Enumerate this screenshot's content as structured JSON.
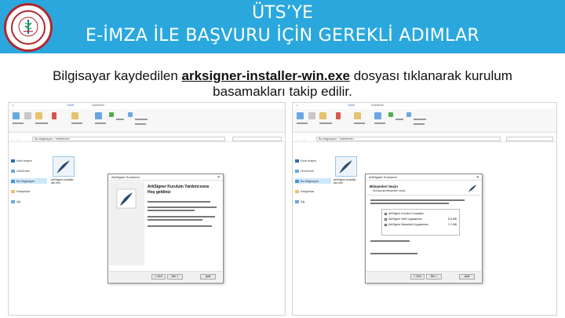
{
  "header": {
    "title_line1": "ÜTS’YE",
    "title_line2": "E-İMZA İLE BAŞVURU İÇİN GEREKLİ ADIMLAR",
    "band_color": "#2aa8de",
    "logo_icon": "university-seal-icon"
  },
  "instruction": {
    "before": "Bilgisayar kaydedilen ",
    "file_name": "arksigner-installer-win.exe",
    "after_line1": " dosyası tıklanarak kurulum",
    "line2": "basamakları takip edilir."
  },
  "left_screenshot": {
    "window_title": "İndirilenler",
    "ribbon_tab_manage": "Yönet",
    "address_nav": "←  →  ↑",
    "address_path": "Bu bilgisayar  ›  İndirilenler",
    "nav_items": [
      "Hızlı erişim",
      "OneDrive",
      "Bu bilgisayar",
      "Kitaplıklar",
      "Ağ"
    ],
    "file_label": "ArkSigner-installer-win.exe",
    "dialog": {
      "title": "ArkSigner Kurulumu",
      "heading": "ArkSigner Kurulum Yardımcısına",
      "heading2": "Hoş geldiniz",
      "back": "< Geri",
      "next": "İleri >",
      "cancel": "İptal"
    }
  },
  "right_screenshot": {
    "window_title": "İndirilenler",
    "ribbon_tab_manage": "Yönet",
    "address_nav": "←  →  ↑",
    "address_path": "Bu bilgisayar  ›  İndirilenler",
    "nav_items": [
      "Hızlı erişim",
      "OneDrive",
      "Bu bilgisayar",
      "Kitaplıklar",
      "Ağ"
    ],
    "file_label": "ArkSigner-installer-win.exe",
    "dialog": {
      "title": "ArkSigner Kurulumu",
      "heading": "Bileşenleri Seçin",
      "subheading": "Kurulacak bileşenleri seçin.",
      "components": [
        {
          "name": "ArkSigner Kurulum Dosyaları",
          "size": ""
        },
        {
          "name": "ArkSigner Web Uygulaması",
          "size": "5.8 MB"
        },
        {
          "name": "ArkSigner Masaüstü Uygulaması",
          "size": "1.2 MB"
        }
      ],
      "back": "< Geri",
      "next": "İleri >",
      "cancel": "İptal"
    }
  }
}
